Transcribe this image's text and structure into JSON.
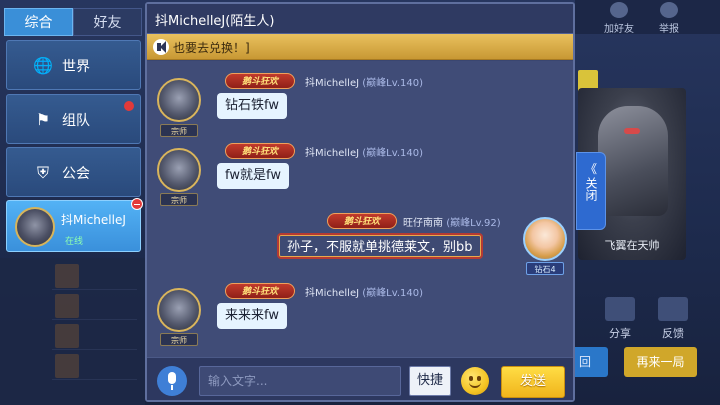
{
  "left_panel": {
    "tabs": [
      "综合",
      "好友"
    ],
    "nav_items": [
      {
        "label": "世界",
        "icon": "globe-icon"
      },
      {
        "label": "组队",
        "icon": "flag-icon"
      },
      {
        "label": "公会",
        "icon": "shield-icon"
      }
    ],
    "active_user": {
      "name": "抖MichelleJ",
      "status": "在线"
    }
  },
  "chat": {
    "title": "抖MichelleJ(陌生人)",
    "notice": "也要去兑换！]",
    "messages": [
      {
        "sender": "抖MichelleJ",
        "level": "(巅峰Lv.140)",
        "badge": "鹅斗狂欢",
        "rank": "宗师",
        "text": "钻石铁fw",
        "mine": false
      },
      {
        "sender": "抖MichelleJ",
        "level": "(巅峰Lv.140)",
        "badge": "鹅斗狂欢",
        "rank": "宗师",
        "text": "fw就是fw",
        "mine": false
      },
      {
        "sender": "旺仔南南",
        "level": "(巅峰Lv.92)",
        "badge": "鹅斗狂欢",
        "rank": "钻石4",
        "text": "孙子，不服就单挑德莱文，别bb",
        "mine": true
      },
      {
        "sender": "抖MichelleJ",
        "level": "(巅峰Lv.140)",
        "badge": "鹅斗狂欢",
        "rank": "宗师",
        "text": "来来来fw",
        "mine": false
      }
    ],
    "input_placeholder": "输入文字...",
    "quick_label": "快捷",
    "send_label": "发送"
  },
  "background": {
    "top_buttons": [
      "加好友",
      "举报"
    ],
    "hero_name": "飞翼在天帅",
    "close_label": "关闭",
    "actions": [
      "分享",
      "反馈"
    ],
    "btn_back": "回",
    "btn_again": "再来一局"
  }
}
